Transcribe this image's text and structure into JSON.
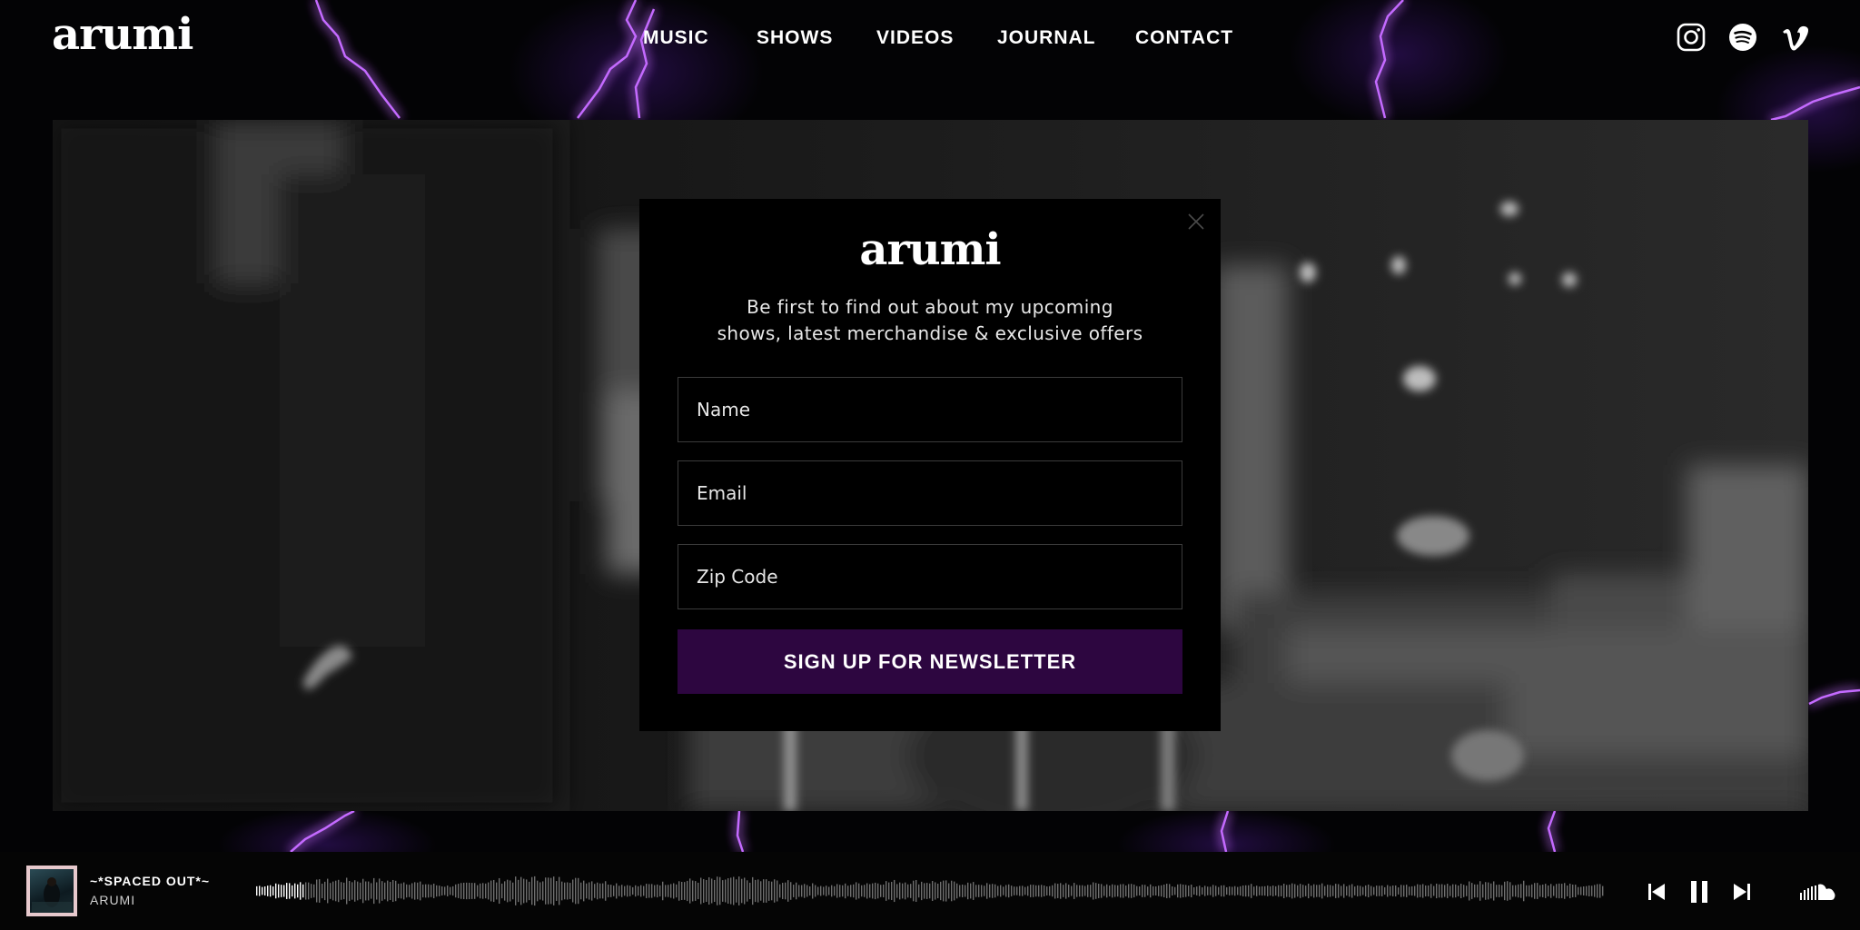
{
  "header": {
    "logo": "arumi",
    "nav": [
      "MUSIC",
      "SHOWS",
      "VIDEOS",
      "JOURNAL",
      "CONTACT"
    ],
    "social": [
      "instagram-icon",
      "spotify-icon",
      "vimeo-icon"
    ]
  },
  "modal": {
    "logo": "arumi",
    "text_line1": "Be first to find out about my upcoming",
    "text_line2": "shows, latest merchandise & exclusive offers",
    "name_placeholder": "Name",
    "email_placeholder": "Email",
    "zip_placeholder": "Zip Code",
    "button": "SIGN UP FOR NEWSLETTER",
    "close_icon": "close-icon"
  },
  "player": {
    "title": "~*SPACED OUT*~",
    "artist": "ARUMI",
    "progress": 0.035,
    "controls": [
      "previous-icon",
      "pause-icon",
      "next-icon",
      "soundcloud-icon"
    ]
  },
  "colors": {
    "background": "#030305",
    "accent": "#2d0640",
    "lightning": "#b44dff",
    "text": "#ffffff"
  }
}
